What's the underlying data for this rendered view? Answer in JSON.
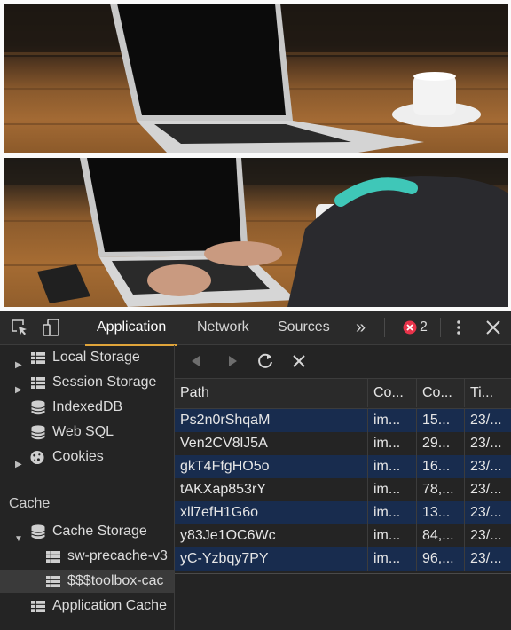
{
  "tabs": {
    "application": "Application",
    "network": "Network",
    "sources": "Sources",
    "more_glyph": "»"
  },
  "toolbar": {
    "error_count": "2",
    "inspect_icon": "inspect-element-icon",
    "device_icon": "device-toolbar-icon",
    "menu_icon": "kebab-menu-icon",
    "close_icon": "close-icon"
  },
  "sidebar": {
    "local_storage": "Local Storage",
    "session_storage": "Session Storage",
    "indexeddb": "IndexedDB",
    "web_sql": "Web SQL",
    "cookies": "Cookies",
    "cache_heading": "Cache",
    "cache_storage": "Cache Storage",
    "cache_entry_1": "sw-precache-v3",
    "cache_entry_2": "$$$toolbox-cac",
    "application_cache": "Application Cache"
  },
  "table": {
    "headers": [
      "Path",
      "Co...",
      "Co...",
      "Ti..."
    ],
    "rows": [
      [
        "Ps2n0rShqaM",
        "im...",
        "15...",
        "23/..."
      ],
      [
        "Ven2CV8lJ5A",
        "im...",
        "29...",
        "23/..."
      ],
      [
        "gkT4FfgHO5o",
        "im...",
        "16...",
        "23/..."
      ],
      [
        "tAKXap853rY",
        "im...",
        "78,...",
        "23/..."
      ],
      [
        "xll7efH1G6o",
        "im...",
        "13...",
        "23/..."
      ],
      [
        "y83Je1OC6Wc",
        "im...",
        "84,...",
        "23/..."
      ],
      [
        "yC-Yzbqy7PY",
        "im...",
        "96,...",
        "23/..."
      ]
    ],
    "selected_rows": [
      0,
      2,
      4,
      6
    ]
  },
  "colors": {
    "accent_tab": "#e0a43a",
    "selection": "#182c4e",
    "error": "#e8334a"
  }
}
